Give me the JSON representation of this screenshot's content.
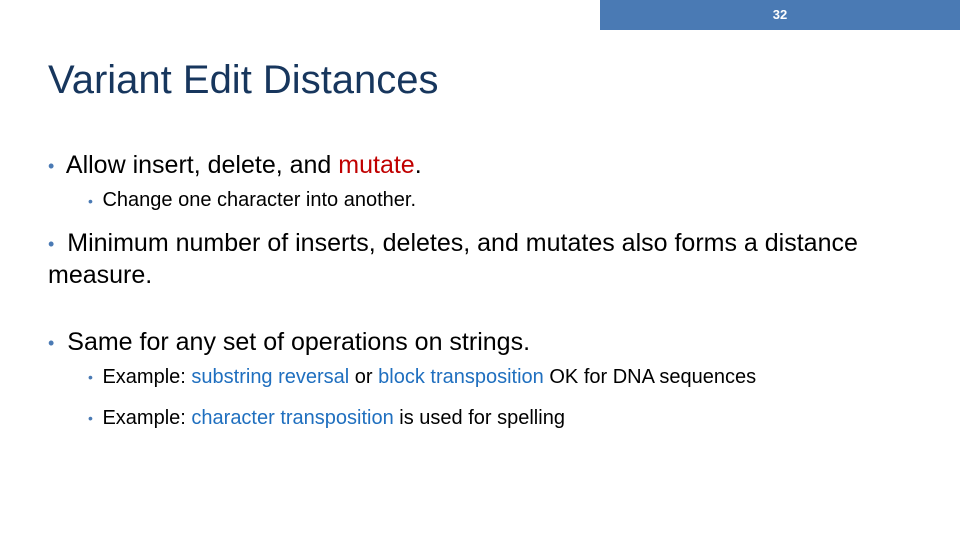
{
  "slide": {
    "number": "32",
    "title": "Variant Edit Distances"
  },
  "colors": {
    "banner": "#4a7ab4",
    "title": "#17365d",
    "bullet": "#4a7ab4",
    "red": "#c00000",
    "blue": "#1f6fbf"
  },
  "b1": {
    "pre": "Allow insert, delete, and ",
    "red": "mutate",
    "post": "."
  },
  "b1_sub": "Change one character into another.",
  "b2": "Minimum number of inserts, deletes, and mutates also forms a distance measure.",
  "b3": "Same for any set of operations on strings.",
  "b3_sub1": {
    "pre": "Example: ",
    "a": "substring reversal",
    "mid": " or ",
    "b": "block transposition",
    "post": " OK for DNA sequences"
  },
  "b3_sub2": {
    "pre": "Example: ",
    "a": "character transposition",
    "post": " is used for spelling"
  }
}
